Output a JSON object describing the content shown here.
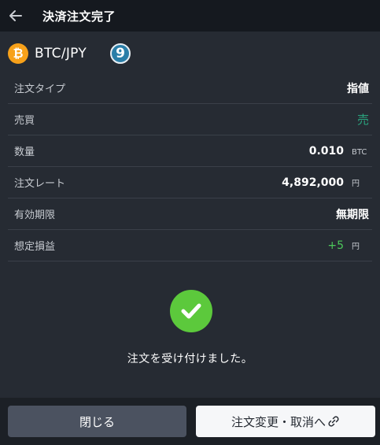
{
  "header": {
    "title": "決済注文完了"
  },
  "symbol": {
    "coin_glyph": "₿",
    "pair": "BTC/JPY",
    "step_badge": "9"
  },
  "details": [
    {
      "label": "注文タイプ",
      "value": "指値",
      "unit": ""
    },
    {
      "label": "売買",
      "value": "売",
      "unit": ""
    },
    {
      "label": "数量",
      "value": "0.010",
      "unit": "BTC"
    },
    {
      "label": "注文レート",
      "value": "4,892,000",
      "unit": "円"
    },
    {
      "label": "有効期限",
      "value": "無期限",
      "unit": ""
    },
    {
      "label": "想定損益",
      "value": "+5",
      "unit": "円"
    }
  ],
  "colors": {
    "sell": "#2aa57f",
    "profit": "#4cc85a",
    "success": "#5cc93c",
    "coin": "#f7a11a"
  },
  "result": {
    "message": "注文を受け付けました。"
  },
  "footer": {
    "close_label": "閉じる",
    "change_label": "注文変更・取消へ"
  }
}
